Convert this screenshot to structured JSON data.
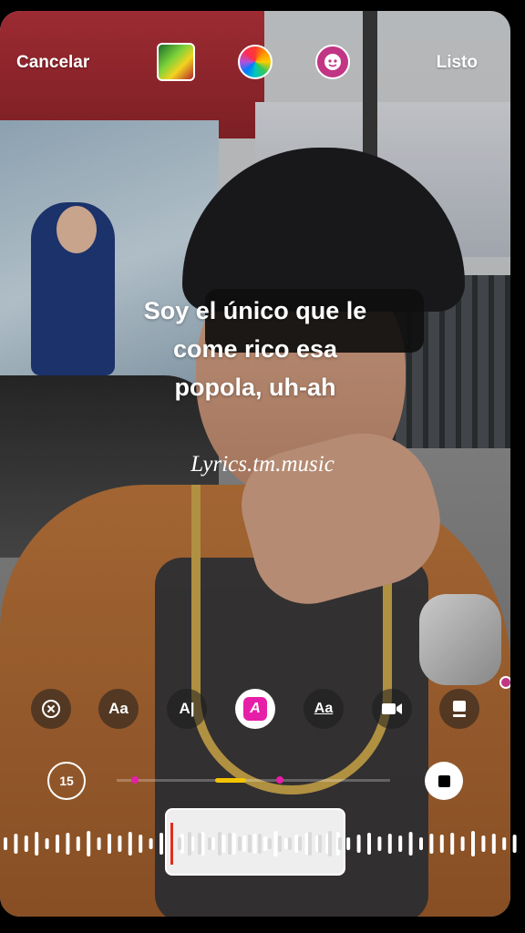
{
  "header": {
    "cancel_label": "Cancelar",
    "done_label": "Listo",
    "album_cover_icon": "album-cover-icon",
    "color_icon": "color-wheel-icon",
    "sticker_icon": "face-sticker-icon"
  },
  "lyrics": {
    "line1": "Soy el único que le",
    "line2": "come rico esa",
    "line3": "popola, uh-ah"
  },
  "watermark": "Lyrics.tm.music",
  "style_toolbar": {
    "items": [
      {
        "name": "remove",
        "icon": "close-circle-icon"
      },
      {
        "name": "font-case",
        "label": "Aa"
      },
      {
        "name": "font-style",
        "label": "A|"
      },
      {
        "name": "highlight",
        "label": "A",
        "active": true
      },
      {
        "name": "underline",
        "label": "Aa"
      },
      {
        "name": "video-layout",
        "icon": "video-icon"
      },
      {
        "name": "card-layout",
        "icon": "card-icon"
      }
    ]
  },
  "duration": {
    "seconds": "15"
  },
  "colors": {
    "accent_pink": "#e61ea8",
    "accent_yellow": "#f5c400",
    "playhead_red": "#e0301e"
  }
}
